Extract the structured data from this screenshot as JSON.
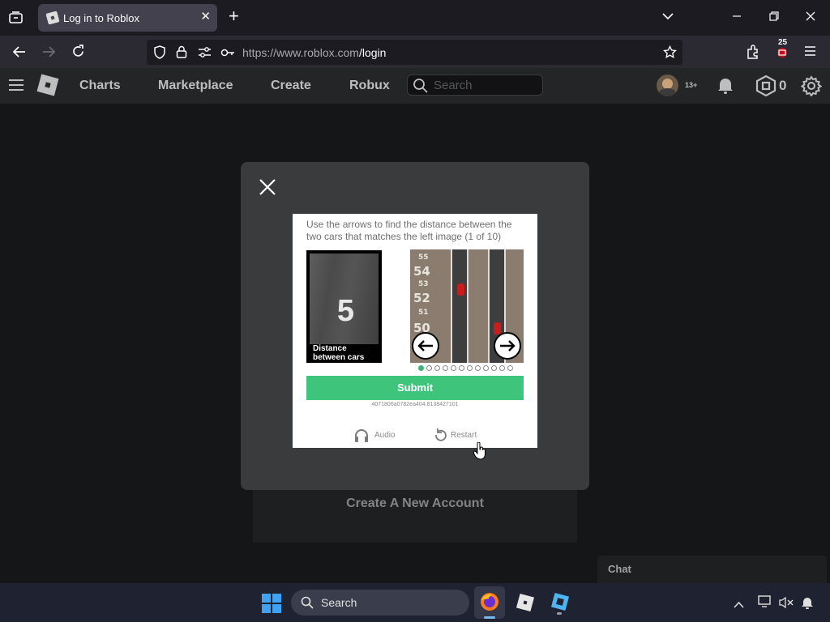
{
  "browser": {
    "tab_title": "Log in to Roblox",
    "url_host": "https://www.roblox.com",
    "url_path": "/login",
    "notification_count": "25"
  },
  "header": {
    "nav": [
      "Charts",
      "Marketplace",
      "Create",
      "Robux"
    ],
    "search_placeholder": "Search",
    "age_badge": "13+",
    "robux_balance": "0"
  },
  "page": {
    "create_account": "Create A New Account",
    "chat_label": "Chat"
  },
  "captcha": {
    "instruction": "Use the arrows to find the distance between the two cars that matches the left image (1 of 10)",
    "reference_value": "5",
    "reference_caption": "Distance between cars",
    "ruler_labels": [
      "55",
      "54",
      "53",
      "52",
      "51",
      "50"
    ],
    "progress_total": 12,
    "progress_current": 1,
    "submit_label": "Submit",
    "session_id": "4071806a0782ea404.8138427101",
    "audio_label": "Audio",
    "restart_label": "Restart"
  },
  "taskbar": {
    "search_label": "Search"
  },
  "colors": {
    "submit_green": "#3fc57b",
    "modal_bg": "#393b3d",
    "header_bg": "#232527"
  }
}
